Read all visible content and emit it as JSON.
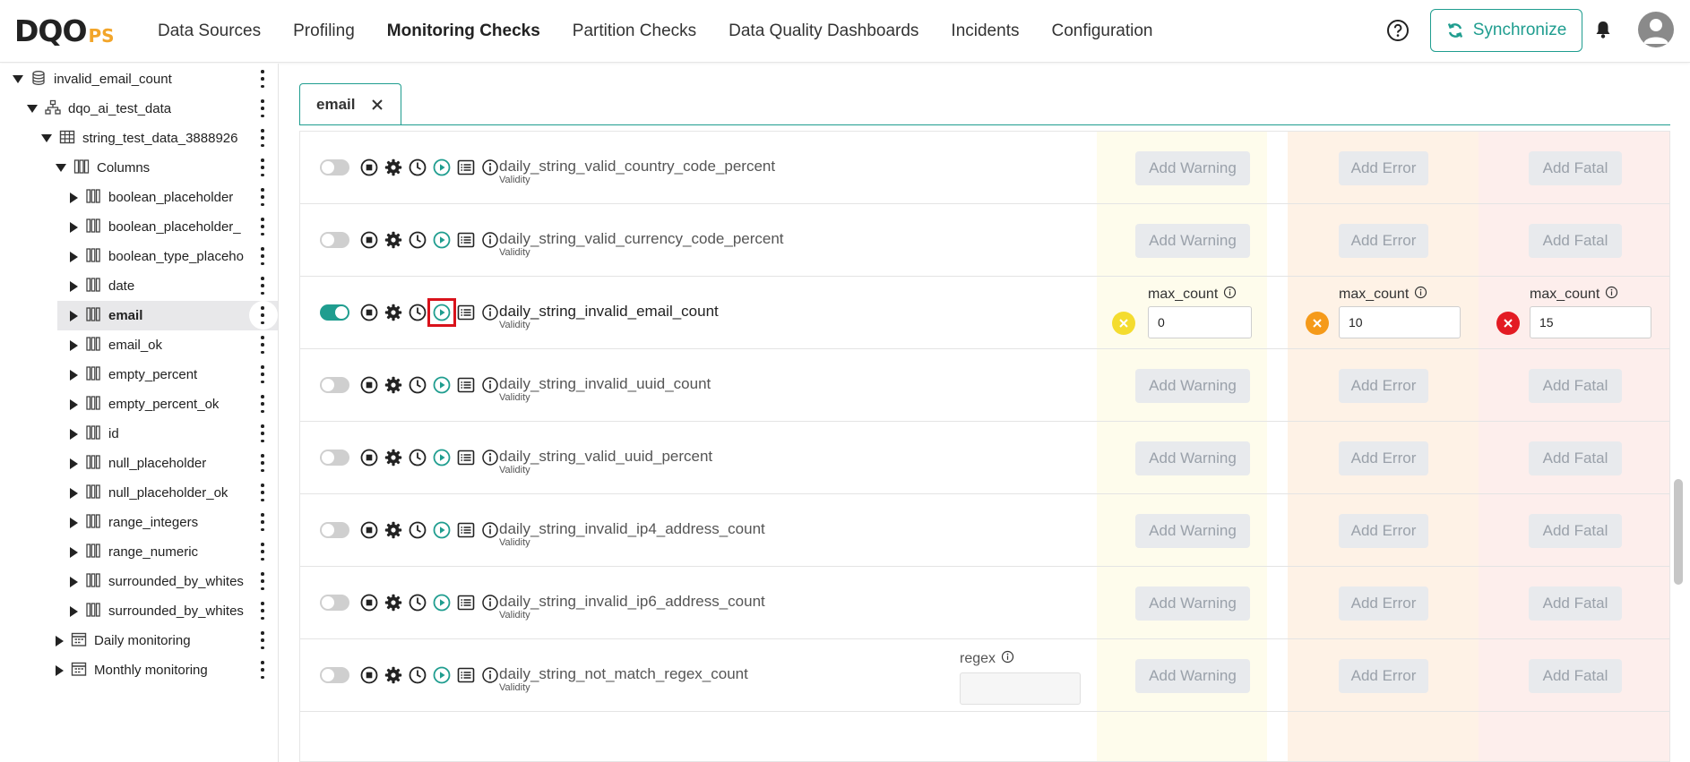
{
  "logo": {
    "main": "DQO",
    "suffix": "PS"
  },
  "nav": [
    {
      "label": "Data Sources",
      "active": false
    },
    {
      "label": "Profiling",
      "active": false
    },
    {
      "label": "Monitoring Checks",
      "active": true
    },
    {
      "label": "Partition Checks",
      "active": false
    },
    {
      "label": "Data Quality Dashboards",
      "active": false
    },
    {
      "label": "Incidents",
      "active": false
    },
    {
      "label": "Configuration",
      "active": false
    }
  ],
  "header": {
    "sync_label": "Synchronize"
  },
  "tree": [
    {
      "label": "invalid_email_count",
      "icon": "database-icon",
      "indent": 0,
      "expander": "down"
    },
    {
      "label": "dqo_ai_test_data",
      "icon": "schema-icon",
      "indent": 1,
      "expander": "down"
    },
    {
      "label": "string_test_data_3888926",
      "icon": "table-icon",
      "indent": 2,
      "expander": "down"
    },
    {
      "label": "Columns",
      "icon": "columns-icon",
      "indent": 3,
      "expander": "down"
    },
    {
      "label": "boolean_placeholder",
      "icon": "column-icon",
      "indent": 4,
      "expander": "right"
    },
    {
      "label": "boolean_placeholder_",
      "icon": "column-icon",
      "indent": 4,
      "expander": "right"
    },
    {
      "label": "boolean_type_placeho",
      "icon": "column-icon",
      "indent": 4,
      "expander": "right"
    },
    {
      "label": "date",
      "icon": "column-icon",
      "indent": 4,
      "expander": "right"
    },
    {
      "label": "email",
      "icon": "column-icon",
      "indent": 4,
      "expander": "right",
      "selected": true
    },
    {
      "label": "email_ok",
      "icon": "column-icon",
      "indent": 4,
      "expander": "right"
    },
    {
      "label": "empty_percent",
      "icon": "column-icon",
      "indent": 4,
      "expander": "right"
    },
    {
      "label": "empty_percent_ok",
      "icon": "column-icon",
      "indent": 4,
      "expander": "right"
    },
    {
      "label": "id",
      "icon": "column-icon",
      "indent": 4,
      "expander": "right"
    },
    {
      "label": "null_placeholder",
      "icon": "column-icon",
      "indent": 4,
      "expander": "right"
    },
    {
      "label": "null_placeholder_ok",
      "icon": "column-icon",
      "indent": 4,
      "expander": "right"
    },
    {
      "label": "range_integers",
      "icon": "column-icon",
      "indent": 4,
      "expander": "right"
    },
    {
      "label": "range_numeric",
      "icon": "column-icon",
      "indent": 4,
      "expander": "right"
    },
    {
      "label": "surrounded_by_whites",
      "icon": "column-icon",
      "indent": 4,
      "expander": "right"
    },
    {
      "label": "surrounded_by_whites",
      "icon": "column-icon",
      "indent": 4,
      "expander": "right"
    },
    {
      "label": "Daily monitoring",
      "icon": "calendar-icon",
      "indent": 3,
      "expander": "right"
    },
    {
      "label": "Monthly monitoring",
      "icon": "calendar-icon",
      "indent": 3,
      "expander": "right"
    }
  ],
  "tab": {
    "label": "email"
  },
  "buttons": {
    "warning": "Add Warning",
    "error": "Add Error",
    "fatal": "Add Fatal"
  },
  "checks": [
    {
      "name": "daily_string_valid_country_code_percent",
      "category": "Validity",
      "enabled": false
    },
    {
      "name": "daily_string_valid_currency_code_percent",
      "category": "Validity",
      "enabled": false
    },
    {
      "name": "daily_string_invalid_email_count",
      "category": "Validity",
      "enabled": true,
      "rules": {
        "warning": {
          "label": "max_count",
          "value": "0"
        },
        "error": {
          "label": "max_count",
          "value": "10"
        },
        "fatal": {
          "label": "max_count",
          "value": "15"
        }
      }
    },
    {
      "name": "daily_string_invalid_uuid_count",
      "category": "Validity",
      "enabled": false
    },
    {
      "name": "daily_string_valid_uuid_percent",
      "category": "Validity",
      "enabled": false
    },
    {
      "name": "daily_string_invalid_ip4_address_count",
      "category": "Validity",
      "enabled": false
    },
    {
      "name": "daily_string_invalid_ip6_address_count",
      "category": "Validity",
      "enabled": false
    },
    {
      "name": "daily_string_not_match_regex_count",
      "category": "Validity",
      "enabled": false,
      "param": {
        "label": "regex",
        "value": ""
      }
    }
  ],
  "colors": {
    "accent": "#1f9d8f",
    "warning": "#f4dc2f",
    "error": "#f59a1a",
    "fatal": "#e31b23",
    "highlight": "#d9121b"
  }
}
